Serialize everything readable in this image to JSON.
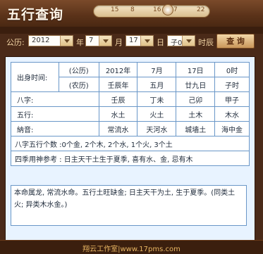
{
  "app": {
    "title": "五行查询"
  },
  "slider": {
    "ticks": [
      "15",
      "8",
      "16",
      "7",
      "22"
    ]
  },
  "controls": {
    "calendar_label": "公历:",
    "year_value": "2012",
    "year_unit": "年",
    "month_value": "7",
    "month_unit": "月",
    "day_value": "17",
    "day_unit": "日",
    "hour_value": "子0",
    "hour_unit": "时辰",
    "query_label": "查 询"
  },
  "table": {
    "birth_label": "出身时间:",
    "solar_label": "(公历)",
    "lunar_label": "(农历)",
    "solar": [
      "2012年",
      "7月",
      "17日",
      "0时"
    ],
    "lunar": [
      "壬辰年",
      "五月",
      "廿九日",
      "子时"
    ],
    "bazi_label": "八字:",
    "bazi": [
      "壬辰",
      "丁未",
      "己卯",
      "甲子"
    ],
    "wuxing_label": "五行:",
    "wuxing": [
      "水土",
      "火土",
      "土木",
      "木水"
    ],
    "nayin_label": "納音:",
    "nayin": [
      "常流水",
      "天河水",
      "城墙土",
      "海中金"
    ],
    "count_text": "八字五行个数 :0个金, 2个木, 2个水, 1个火, 3个土",
    "season_text": "四季用神参考 : 日主天干土生于夏季, 喜有水、金, 忌有木"
  },
  "summary": "本命属龙, 常流水命。五行土旺缺金; 日主天干为土, 生于夏季。(同类土火; 异类木水金。)",
  "footer": {
    "text": "翔云工作室|www.17pms.com"
  }
}
